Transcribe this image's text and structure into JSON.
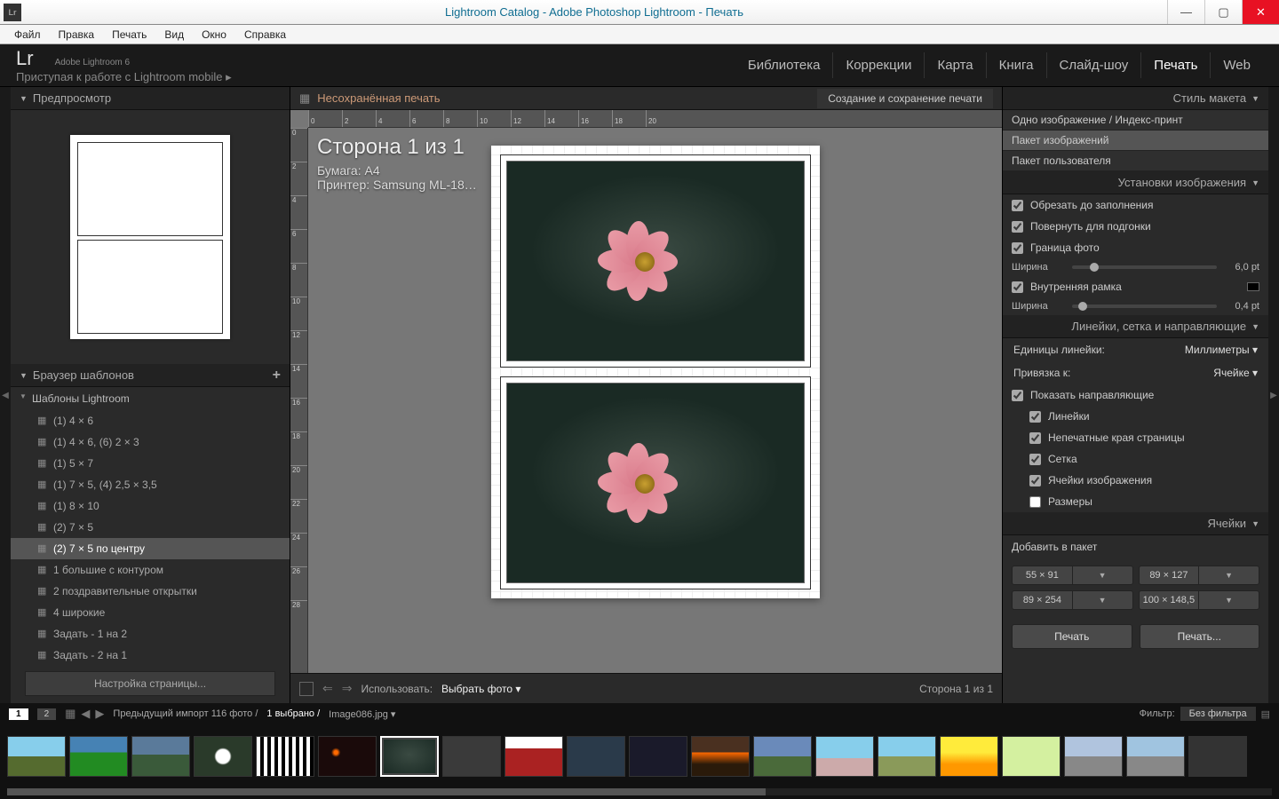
{
  "window": {
    "title": "Lightroom Catalog - Adobe Photoshop Lightroom - Печать"
  },
  "menu": {
    "items": [
      "Файл",
      "Правка",
      "Печать",
      "Вид",
      "Окно",
      "Справка"
    ]
  },
  "brand": {
    "logo": "Lr",
    "product": "Adobe Lightroom 6",
    "sub": "Приступая к работе с Lightroom mobile  ▸"
  },
  "tabs": {
    "items": [
      "Библиотека",
      "Коррекции",
      "Карта",
      "Книга",
      "Слайд-шоу",
      "Печать",
      "Web"
    ],
    "active": "Печать"
  },
  "left": {
    "preview_hdr": "Предпросмотр",
    "browser_hdr": "Браузер шаблонов",
    "folder": "Шаблоны Lightroom",
    "templates": [
      "(1) 4 × 6",
      "(1) 4 × 6, (6) 2 × 3",
      "(1) 5 × 7",
      "(1) 7 × 5, (4) 2,5 × 3,5",
      "(1) 8 × 10",
      "(2) 7 × 5",
      "(2) 7 × 5 по центру",
      "1 большие с контуром",
      "2 поздравительные открытки",
      "4 широкие",
      "Задать - 1 на 2",
      "Задать - 2 на 1"
    ],
    "selected": "(2) 7 × 5 по центру",
    "page_setup_btn": "Настройка страницы..."
  },
  "center": {
    "title_prefix": "Несохранённая печать",
    "save_btn": "Создание и сохранение печати",
    "page_title": "Сторона 1 из 1",
    "paper_label": "Бумага:  A4",
    "printer_label": "Принтер:  Samsung ML-18…",
    "use_label": "Использовать:",
    "use_value": "Выбрать фото ▾",
    "page_status": "Сторона 1 из 1",
    "ruler_h": [
      "0",
      "2",
      "4",
      "6",
      "8",
      "10",
      "12",
      "14",
      "16",
      "18",
      "20"
    ],
    "ruler_v": [
      "0",
      "2",
      "4",
      "6",
      "8",
      "10",
      "12",
      "14",
      "16",
      "18",
      "20",
      "22",
      "24",
      "26",
      "28"
    ]
  },
  "right": {
    "layout_style_hdr": "Стиль макета",
    "layout_opts": [
      "Одно изображение / Индекс-принт",
      "Пакет изображений",
      "Пакет пользователя"
    ],
    "layout_sel": "Пакет изображений",
    "img_settings_hdr": "Установки изображения",
    "crop_fill": "Обрезать до заполнения",
    "rotate_fit": "Повернуть для подгонки",
    "photo_border": "Граница фото",
    "width_lbl": "Ширина",
    "border_val": "6,0  pt",
    "inner_frame": "Внутренняя рамка",
    "inner_val": "0,4  pt",
    "guides_hdr": "Линейки, сетка и направляющие",
    "units_lbl": "Единицы линейки:",
    "units_val": "Миллиметры ▾",
    "snap_lbl": "Привязка к:",
    "snap_val": "Ячейке ▾",
    "show_guides": "Показать направляющие",
    "g_rulers": "Линейки",
    "g_margins": "Непечатные края страницы",
    "g_grid": "Сетка",
    "g_cells": "Ячейки изображения",
    "g_dims": "Размеры",
    "cells_hdr": "Ячейки",
    "add_pack": "Добавить в пакет",
    "cell_sizes": [
      "55 × 91",
      "89 × 127",
      "89 × 254",
      "100 × 148,5"
    ],
    "print_btn": "Печать",
    "print_dlg_btn": "Печать..."
  },
  "filmstrip": {
    "badge1": "1",
    "badge2": "2",
    "path_prefix": "Предыдущий импорт   116 фото /",
    "selected": "1 выбрано /",
    "filename": "Image086.jpg ▾",
    "filter_lbl": "Фильтр:",
    "filter_val": "Без фильтра"
  }
}
